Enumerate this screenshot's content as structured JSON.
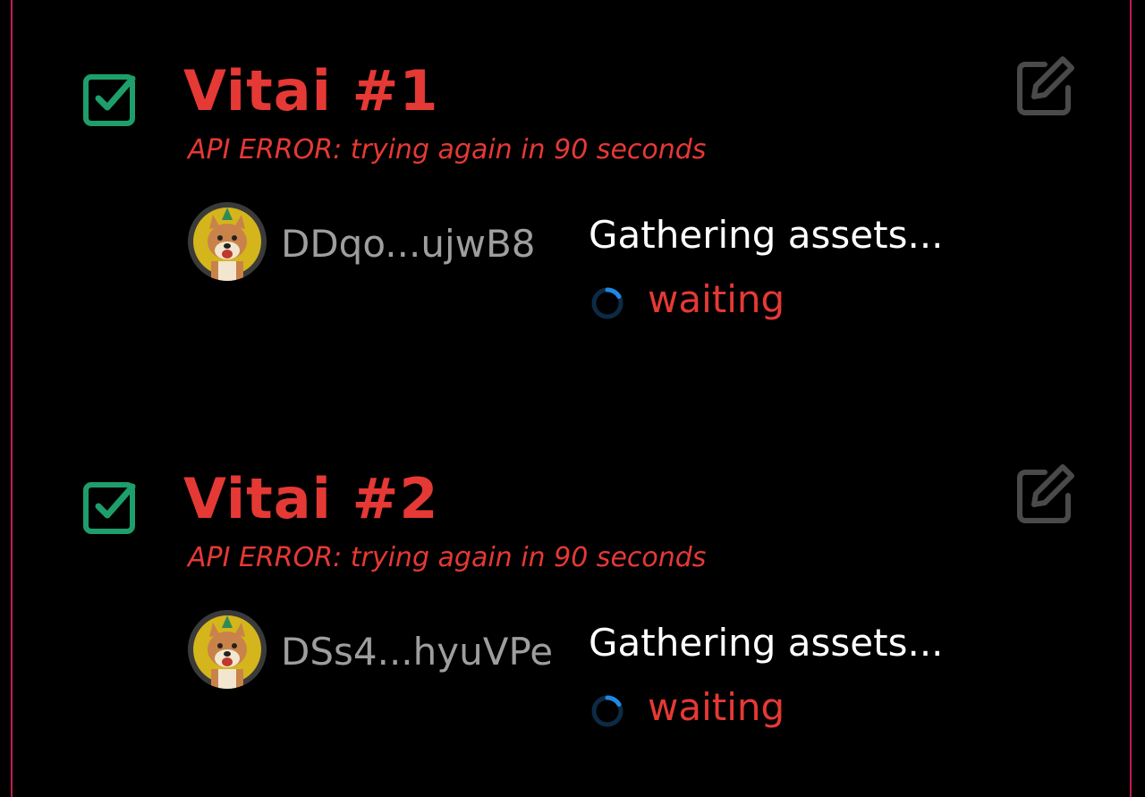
{
  "colors": {
    "title": "#e53935",
    "error": "#e53935",
    "check": "#1e9e6b",
    "edit": "#4a4a4a",
    "frame": "#c2185b",
    "wallet": "#9e9e9e",
    "status": "#ffffff",
    "spinner": "#1e88e5"
  },
  "cards": [
    {
      "title": "Vitai #1",
      "error": "API ERROR: trying again in 90 seconds",
      "wallet": "DDqo...ujwB8",
      "status": "Gathering assets...",
      "state": "waiting",
      "checked": true,
      "icons": [
        "checkbox-checked-icon",
        "edit-icon",
        "avatar-doge-image",
        "loading-spinner-icon"
      ]
    },
    {
      "title": "Vitai #2",
      "error": "API ERROR: trying again in 90 seconds",
      "wallet": "DSs4...hyuVPe",
      "status": "Gathering assets...",
      "state": "waiting",
      "checked": true,
      "icons": [
        "checkbox-checked-icon",
        "edit-icon",
        "avatar-doge-image",
        "loading-spinner-icon"
      ]
    }
  ]
}
